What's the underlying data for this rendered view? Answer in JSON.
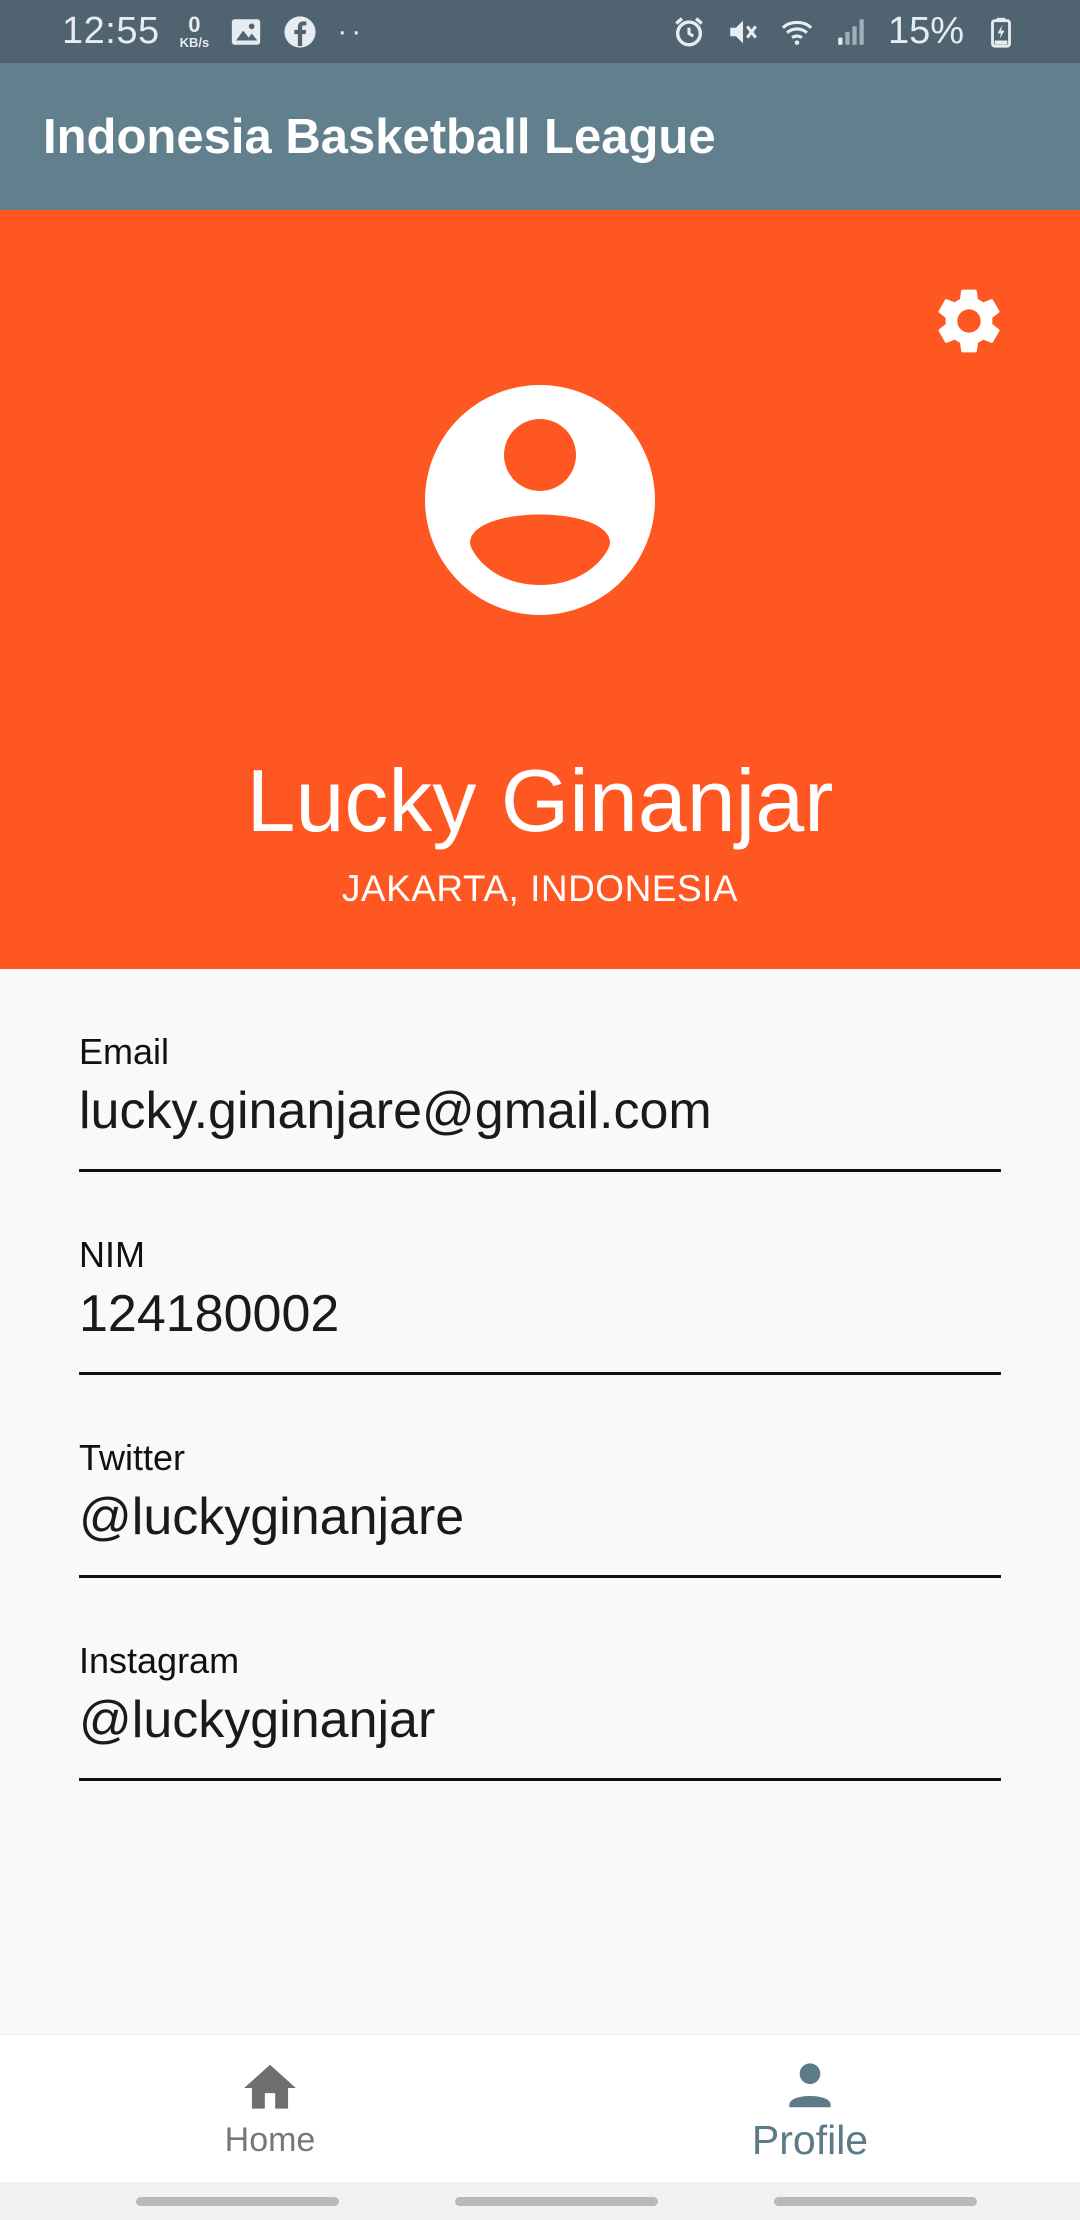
{
  "status_bar": {
    "time": "12:55",
    "speed_value": "0",
    "speed_unit": "KB/s",
    "more_dots": "··",
    "battery_percent": "15%"
  },
  "app_bar": {
    "title": "Indonesia Basketball League"
  },
  "profile": {
    "name": "Lucky Ginanjar",
    "location": "JAKARTA, INDONESIA"
  },
  "fields": [
    {
      "label": "Email",
      "value": "lucky.ginanjare@gmail.com"
    },
    {
      "label": "NIM",
      "value": "124180002"
    },
    {
      "label": "Twitter",
      "value": "@luckyginanjare"
    },
    {
      "label": "Instagram",
      "value": "@luckyginanjar"
    }
  ],
  "bottom_nav": {
    "items": [
      {
        "label": "Home",
        "icon": "home-icon"
      },
      {
        "label": "Profile",
        "icon": "person-icon",
        "active": true
      }
    ]
  },
  "colors": {
    "header": "#ff5722",
    "app_bar": "#617f8c",
    "status_bar": "#4f6370",
    "active_nav": "#5d7a89"
  }
}
